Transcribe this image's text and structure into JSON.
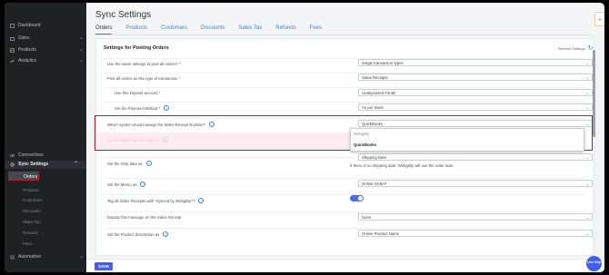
{
  "sidebar": {
    "items": [
      {
        "label": "Dashboard",
        "icon": "dashboard-icon"
      },
      {
        "label": "Sales",
        "icon": "sales-icon"
      },
      {
        "label": "Products",
        "icon": "products-icon"
      },
      {
        "label": "Analytics",
        "icon": "analytics-icon"
      }
    ],
    "bottom_items": [
      {
        "label": "Connections",
        "icon": "connections-icon"
      }
    ],
    "sync_settings": {
      "label": "Sync Settings",
      "icon": "sync-icon"
    },
    "sync_children": [
      "Orders",
      "Products",
      "Customers",
      "Discounts",
      "Sales Tax",
      "Refunds",
      "Fees"
    ],
    "automation": {
      "label": "Automation",
      "icon": "automation-icon"
    }
  },
  "header": {
    "title": "Sync Settings",
    "tabs": [
      "Orders",
      "Products",
      "Customers",
      "Discounts",
      "Sales Tax",
      "Refunds",
      "Fees"
    ],
    "active_tab": "Orders"
  },
  "card": {
    "title": "Settings for Posting Orders",
    "refresh_label": "Refresh Settings"
  },
  "rows": [
    {
      "label": "Use the same settings to post all orders? *",
      "value": "Single transaction types",
      "help": false
    },
    {
      "label": "Post all orders as this type of transaction *",
      "value": "Sales Receipts",
      "help": false
    },
    {
      "label": "Use this Deposit account *",
      "value": "Undeposited Funds",
      "help": false
    },
    {
      "label": "Set the Payment Method *",
      "value": "As per Store",
      "help": true
    },
    {
      "label": "Which system should assign the Sales Receipt Number?",
      "value": "QuickBooks",
      "help": true
    },
    {
      "label": "Set the Sales Receipt Date as",
      "value": "",
      "help": true
    },
    {
      "label": "Set the Ship date as",
      "value": "Shipping Date",
      "help": true
    },
    {
      "label": "Set the Memo as",
      "value": "Online Order#",
      "help": true
    },
    {
      "label": "Tag all Sales Receipts with \"Synced by Webgility\"?",
      "value": "",
      "help": true
    },
    {
      "label": "Display this message on the Sales Receipt",
      "value": "None",
      "help": false
    },
    {
      "label": "Set the Product description as",
      "value": "Online Product Name",
      "help": true
    }
  ],
  "dropdown": {
    "options": [
      "Webgility",
      "QuickBooks"
    ],
    "selected": "QuickBooks"
  },
  "hint": "If there is no shipping date, Webgility will use the order date.",
  "toggle": {
    "on": true
  },
  "footer": {
    "save_label": "SAVE",
    "help_label": "Live Help"
  },
  "corner_icon": "+",
  "colors": {
    "accent": "#3f5ff0",
    "highlight": "#b41d2a",
    "sidebar": "#1f2224"
  }
}
